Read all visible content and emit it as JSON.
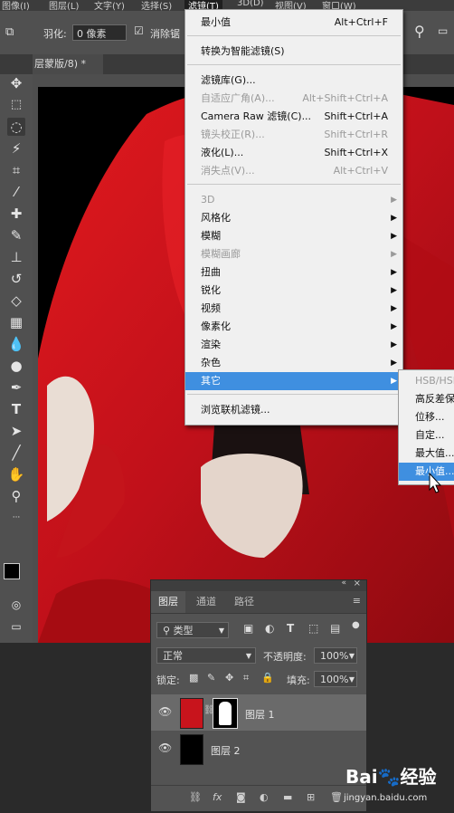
{
  "menubar": {
    "items": [
      "图像(I)",
      "图层(L)",
      "文字(Y)",
      "选择(S)",
      "滤镜(T)",
      "3D(D)",
      "视图(V)",
      "窗口(W)"
    ]
  },
  "options_bar": {
    "feather_label": "羽化:",
    "feather_value": "0 像素",
    "antialias_label": "消除锯"
  },
  "document_tab": {
    "title": "层蒙版/8) *"
  },
  "filter_menu": {
    "items": [
      {
        "label": "最小值",
        "shortcut": "Alt+Ctrl+F",
        "state": "normal"
      },
      {
        "label": "转换为智能滤镜(S)",
        "shortcut": "",
        "state": "normal"
      },
      {
        "label": "滤镜库(G)...",
        "shortcut": "",
        "state": "normal"
      },
      {
        "label": "自适应广角(A)...",
        "shortcut": "Alt+Shift+Ctrl+A",
        "state": "disabled"
      },
      {
        "label": "Camera Raw 滤镜(C)...",
        "shortcut": "Shift+Ctrl+A",
        "state": "normal"
      },
      {
        "label": "镜头校正(R)...",
        "shortcut": "Shift+Ctrl+R",
        "state": "disabled"
      },
      {
        "label": "液化(L)...",
        "shortcut": "Shift+Ctrl+X",
        "state": "normal"
      },
      {
        "label": "消失点(V)...",
        "shortcut": "Alt+Ctrl+V",
        "state": "disabled"
      },
      {
        "label": "3D",
        "shortcut": "",
        "state": "disabled",
        "submenu": true
      },
      {
        "label": "风格化",
        "shortcut": "",
        "state": "normal",
        "submenu": true
      },
      {
        "label": "模糊",
        "shortcut": "",
        "state": "normal",
        "submenu": true
      },
      {
        "label": "模糊画廊",
        "shortcut": "",
        "state": "disabled",
        "submenu": true
      },
      {
        "label": "扭曲",
        "shortcut": "",
        "state": "normal",
        "submenu": true
      },
      {
        "label": "锐化",
        "shortcut": "",
        "state": "normal",
        "submenu": true
      },
      {
        "label": "视频",
        "shortcut": "",
        "state": "normal",
        "submenu": true
      },
      {
        "label": "像素化",
        "shortcut": "",
        "state": "normal",
        "submenu": true
      },
      {
        "label": "渲染",
        "shortcut": "",
        "state": "normal",
        "submenu": true
      },
      {
        "label": "杂色",
        "shortcut": "",
        "state": "normal",
        "submenu": true
      },
      {
        "label": "其它",
        "shortcut": "",
        "state": "highlighted",
        "submenu": true
      },
      {
        "label": "浏览联机滤镜...",
        "shortcut": "",
        "state": "normal"
      }
    ]
  },
  "other_submenu": {
    "items": [
      {
        "label": "HSB/HSL",
        "state": "disabled"
      },
      {
        "label": "高反差保留...",
        "state": "normal"
      },
      {
        "label": "位移...",
        "state": "normal"
      },
      {
        "label": "自定...",
        "state": "normal"
      },
      {
        "label": "最大值...",
        "state": "normal"
      },
      {
        "label": "最小值...",
        "state": "highlighted"
      }
    ]
  },
  "layers_panel": {
    "tabs": [
      "图层",
      "通道",
      "路径"
    ],
    "filter_kind": "类型",
    "blend_mode": "正常",
    "opacity_label": "不透明度:",
    "opacity_value": "100%",
    "lock_label": "锁定:",
    "fill_label": "填充:",
    "fill_value": "100%",
    "layers": [
      {
        "name": "图层 1",
        "selected": true
      },
      {
        "name": "图层 2",
        "selected": false
      }
    ]
  },
  "watermark": {
    "brand_text": "Bai",
    "brand_text2": "经验",
    "url": "jingyan.baidu.com"
  },
  "colors": {
    "menu_highlight": "#3f8fe0",
    "ui_dark": "#535353",
    "cloth_red": "#d0141a"
  }
}
